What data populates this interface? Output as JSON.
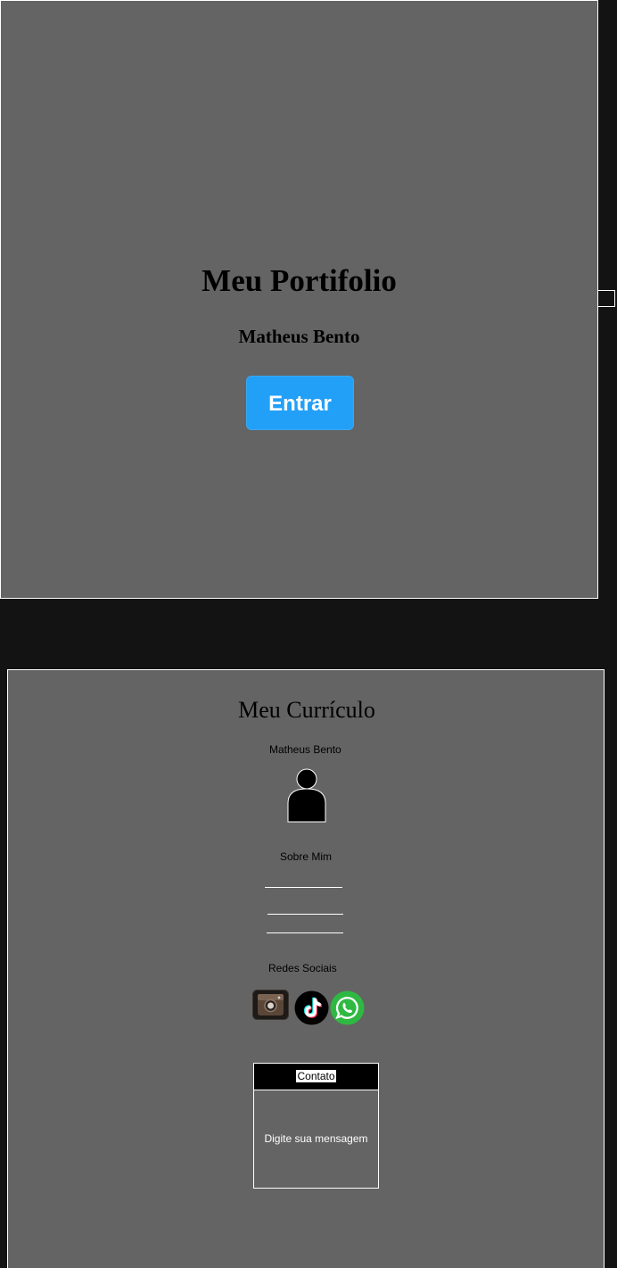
{
  "hero": {
    "title": "Meu Portifolio",
    "subtitle": "Matheus Bento",
    "enter_label": "Entrar"
  },
  "curriculum": {
    "title": "Meu Currículo",
    "name": "Matheus Bento",
    "about_heading": "Sobre Mim",
    "social_heading": "Redes Sociais",
    "social_links": [
      {
        "name": "instagram-icon"
      },
      {
        "name": "tiktok-icon"
      },
      {
        "name": "whatsapp-icon"
      }
    ],
    "contact": {
      "label": "Contato",
      "message_placeholder": "Digite sua mensagem"
    }
  },
  "colors": {
    "page_background": "#131313",
    "panel_background": "#646464",
    "button_accent": "#22a0f8",
    "whatsapp_green": "#2fb942"
  }
}
